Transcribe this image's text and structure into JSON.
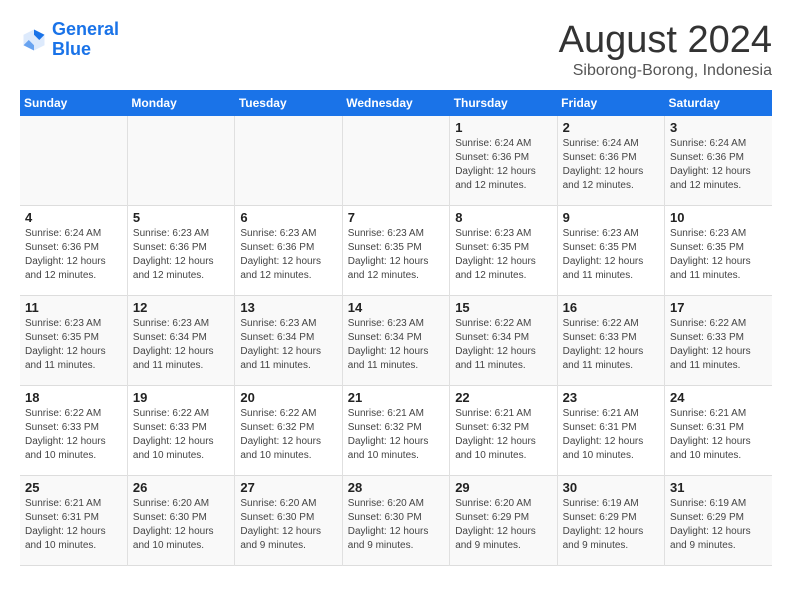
{
  "logo": {
    "line1": "General",
    "line2": "Blue"
  },
  "header": {
    "month": "August 2024",
    "location": "Siborong-Borong, Indonesia"
  },
  "weekdays": [
    "Sunday",
    "Monday",
    "Tuesday",
    "Wednesday",
    "Thursday",
    "Friday",
    "Saturday"
  ],
  "weeks": [
    [
      {
        "day": "",
        "info": ""
      },
      {
        "day": "",
        "info": ""
      },
      {
        "day": "",
        "info": ""
      },
      {
        "day": "",
        "info": ""
      },
      {
        "day": "1",
        "info": "Sunrise: 6:24 AM\nSunset: 6:36 PM\nDaylight: 12 hours\nand 12 minutes."
      },
      {
        "day": "2",
        "info": "Sunrise: 6:24 AM\nSunset: 6:36 PM\nDaylight: 12 hours\nand 12 minutes."
      },
      {
        "day": "3",
        "info": "Sunrise: 6:24 AM\nSunset: 6:36 PM\nDaylight: 12 hours\nand 12 minutes."
      }
    ],
    [
      {
        "day": "4",
        "info": "Sunrise: 6:24 AM\nSunset: 6:36 PM\nDaylight: 12 hours\nand 12 minutes."
      },
      {
        "day": "5",
        "info": "Sunrise: 6:23 AM\nSunset: 6:36 PM\nDaylight: 12 hours\nand 12 minutes."
      },
      {
        "day": "6",
        "info": "Sunrise: 6:23 AM\nSunset: 6:36 PM\nDaylight: 12 hours\nand 12 minutes."
      },
      {
        "day": "7",
        "info": "Sunrise: 6:23 AM\nSunset: 6:35 PM\nDaylight: 12 hours\nand 12 minutes."
      },
      {
        "day": "8",
        "info": "Sunrise: 6:23 AM\nSunset: 6:35 PM\nDaylight: 12 hours\nand 12 minutes."
      },
      {
        "day": "9",
        "info": "Sunrise: 6:23 AM\nSunset: 6:35 PM\nDaylight: 12 hours\nand 11 minutes."
      },
      {
        "day": "10",
        "info": "Sunrise: 6:23 AM\nSunset: 6:35 PM\nDaylight: 12 hours\nand 11 minutes."
      }
    ],
    [
      {
        "day": "11",
        "info": "Sunrise: 6:23 AM\nSunset: 6:35 PM\nDaylight: 12 hours\nand 11 minutes."
      },
      {
        "day": "12",
        "info": "Sunrise: 6:23 AM\nSunset: 6:34 PM\nDaylight: 12 hours\nand 11 minutes."
      },
      {
        "day": "13",
        "info": "Sunrise: 6:23 AM\nSunset: 6:34 PM\nDaylight: 12 hours\nand 11 minutes."
      },
      {
        "day": "14",
        "info": "Sunrise: 6:23 AM\nSunset: 6:34 PM\nDaylight: 12 hours\nand 11 minutes."
      },
      {
        "day": "15",
        "info": "Sunrise: 6:22 AM\nSunset: 6:34 PM\nDaylight: 12 hours\nand 11 minutes."
      },
      {
        "day": "16",
        "info": "Sunrise: 6:22 AM\nSunset: 6:33 PM\nDaylight: 12 hours\nand 11 minutes."
      },
      {
        "day": "17",
        "info": "Sunrise: 6:22 AM\nSunset: 6:33 PM\nDaylight: 12 hours\nand 11 minutes."
      }
    ],
    [
      {
        "day": "18",
        "info": "Sunrise: 6:22 AM\nSunset: 6:33 PM\nDaylight: 12 hours\nand 10 minutes."
      },
      {
        "day": "19",
        "info": "Sunrise: 6:22 AM\nSunset: 6:33 PM\nDaylight: 12 hours\nand 10 minutes."
      },
      {
        "day": "20",
        "info": "Sunrise: 6:22 AM\nSunset: 6:32 PM\nDaylight: 12 hours\nand 10 minutes."
      },
      {
        "day": "21",
        "info": "Sunrise: 6:21 AM\nSunset: 6:32 PM\nDaylight: 12 hours\nand 10 minutes."
      },
      {
        "day": "22",
        "info": "Sunrise: 6:21 AM\nSunset: 6:32 PM\nDaylight: 12 hours\nand 10 minutes."
      },
      {
        "day": "23",
        "info": "Sunrise: 6:21 AM\nSunset: 6:31 PM\nDaylight: 12 hours\nand 10 minutes."
      },
      {
        "day": "24",
        "info": "Sunrise: 6:21 AM\nSunset: 6:31 PM\nDaylight: 12 hours\nand 10 minutes."
      }
    ],
    [
      {
        "day": "25",
        "info": "Sunrise: 6:21 AM\nSunset: 6:31 PM\nDaylight: 12 hours\nand 10 minutes."
      },
      {
        "day": "26",
        "info": "Sunrise: 6:20 AM\nSunset: 6:30 PM\nDaylight: 12 hours\nand 10 minutes."
      },
      {
        "day": "27",
        "info": "Sunrise: 6:20 AM\nSunset: 6:30 PM\nDaylight: 12 hours\nand 9 minutes."
      },
      {
        "day": "28",
        "info": "Sunrise: 6:20 AM\nSunset: 6:30 PM\nDaylight: 12 hours\nand 9 minutes."
      },
      {
        "day": "29",
        "info": "Sunrise: 6:20 AM\nSunset: 6:29 PM\nDaylight: 12 hours\nand 9 minutes."
      },
      {
        "day": "30",
        "info": "Sunrise: 6:19 AM\nSunset: 6:29 PM\nDaylight: 12 hours\nand 9 minutes."
      },
      {
        "day": "31",
        "info": "Sunrise: 6:19 AM\nSunset: 6:29 PM\nDaylight: 12 hours\nand 9 minutes."
      }
    ]
  ]
}
